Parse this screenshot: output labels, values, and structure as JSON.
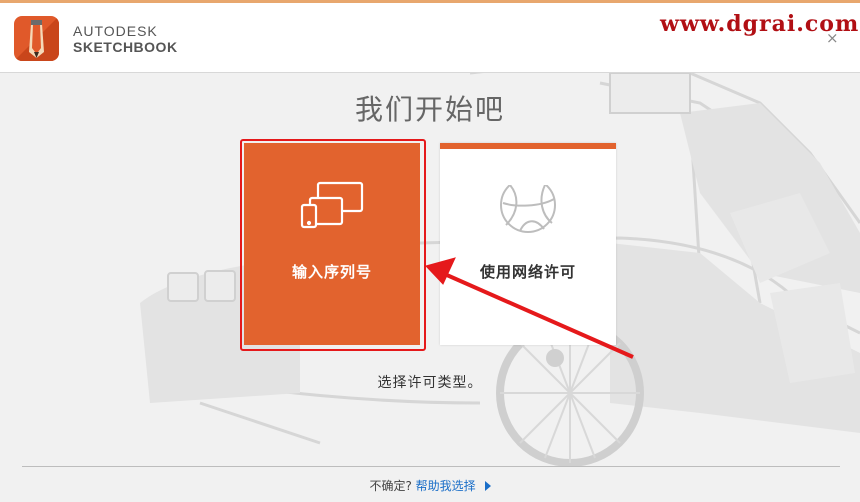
{
  "header": {
    "brand_line1": "AUTODESK",
    "brand_line2": "SKETCHBOOK",
    "watermark": "www.dgrai.com",
    "close_glyph": "×"
  },
  "main": {
    "heading": "我们开始吧",
    "options": [
      {
        "label": "输入序列号",
        "icon": "devices-icon"
      },
      {
        "label": "使用网络许可",
        "icon": "network-globe-icon"
      }
    ],
    "subtext": "选择许可类型。"
  },
  "footer": {
    "prompt": "不确定?",
    "help_link": "帮助我选择"
  },
  "colors": {
    "accent": "#e2632e",
    "highlight_border": "#e5191b",
    "watermark": "#b10f14",
    "link": "#1a6ec8"
  }
}
